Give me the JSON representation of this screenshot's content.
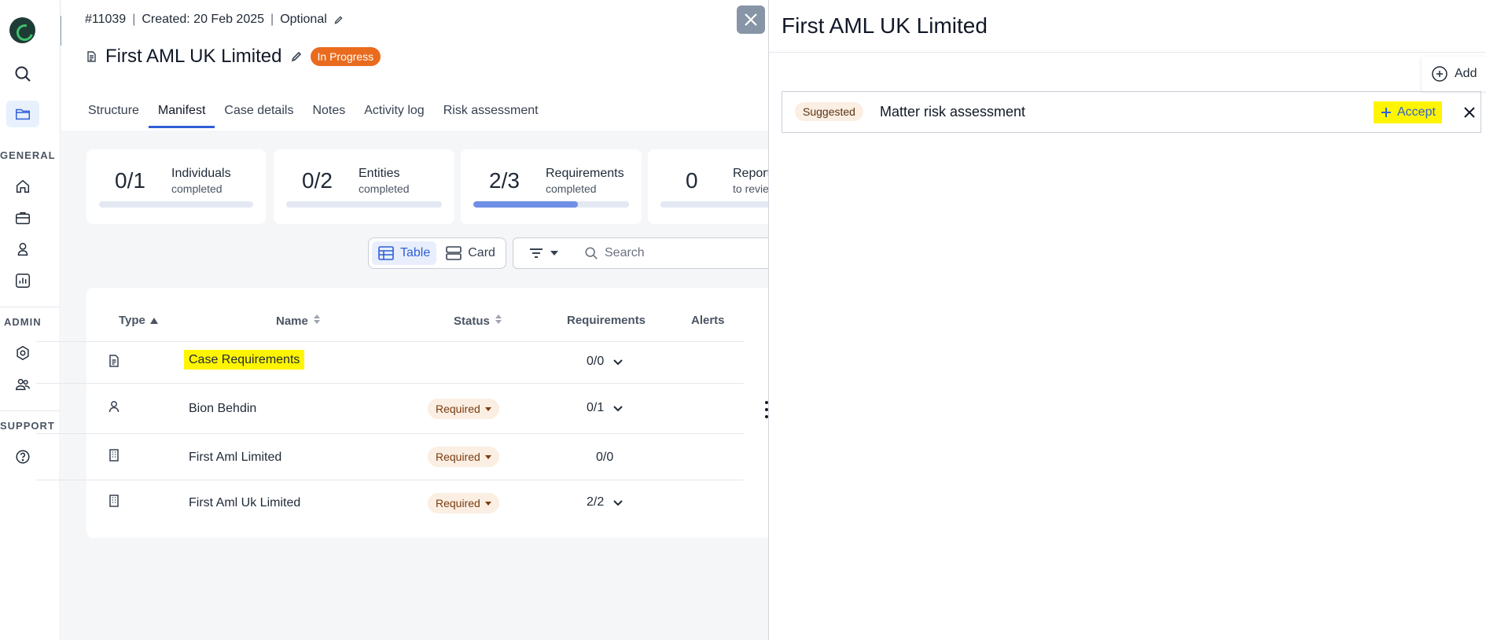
{
  "sidebar": {
    "sections": {
      "general": "GENERAL",
      "admin": "ADMIN",
      "support": "SUPPORT"
    },
    "icons": [
      "logo",
      "search-icon",
      "folder-icon",
      "home-icon",
      "briefcase-icon",
      "person-icon",
      "chart-icon",
      "settings-icon",
      "team-icon",
      "help-icon"
    ]
  },
  "case": {
    "id": "#11039",
    "created": "Created: 20 Feb 2025",
    "optional": "Optional",
    "title": "First AML UK Limited",
    "status": "In Progress"
  },
  "tabs": [
    {
      "label": "Structure",
      "active": false
    },
    {
      "label": "Manifest",
      "active": true
    },
    {
      "label": "Case details",
      "active": false
    },
    {
      "label": "Notes",
      "active": false
    },
    {
      "label": "Activity log",
      "active": false
    },
    {
      "label": "Risk assessment",
      "active": false
    }
  ],
  "stats": [
    {
      "value": "0/1",
      "label": "Individuals",
      "sub": "completed",
      "progress": 0
    },
    {
      "value": "0/2",
      "label": "Entities",
      "sub": "completed",
      "progress": 0
    },
    {
      "value": "2/3",
      "label": "Requirements",
      "sub": "completed",
      "progress": 0.67
    },
    {
      "value": "0",
      "label": "Report",
      "sub": "to revie",
      "progress": 0
    }
  ],
  "toolbar": {
    "table_label": "Table",
    "card_label": "Card",
    "search_placeholder": "Search"
  },
  "table": {
    "headers": {
      "type": "Type",
      "name": "Name",
      "status": "Status",
      "requirements": "Requirements",
      "alerts": "Alerts"
    },
    "rows": [
      {
        "type_icon": "document-icon",
        "name": "Case Requirements",
        "status": "",
        "requirements": "0/0",
        "expandable": true
      },
      {
        "type_icon": "person-icon",
        "name": "Bion Behdin",
        "status": "Required",
        "requirements": "0/1",
        "expandable": true
      },
      {
        "type_icon": "building-icon",
        "name": "First Aml Limited",
        "status": "Required",
        "requirements": "0/0",
        "expandable": false
      },
      {
        "type_icon": "building-icon",
        "name": "First Aml Uk Limited",
        "status": "Required",
        "requirements": "2/2",
        "expandable": true
      }
    ]
  },
  "panel": {
    "title": "First AML UK Limited",
    "add_label": "Add",
    "suggestion": {
      "badge": "Suggested",
      "name": "Matter risk assessment",
      "accept_label": "Accept"
    }
  },
  "colors": {
    "accent": "#2f5fd7",
    "status_progress": "#e96b1e",
    "highlight": "#fff500",
    "badge_bg": "#fbeee2"
  }
}
